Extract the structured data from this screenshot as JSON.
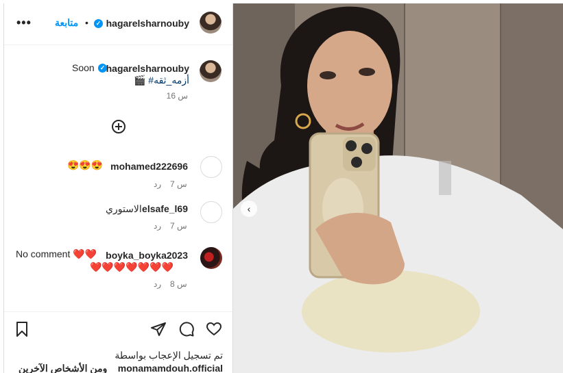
{
  "header": {
    "username": "hagarelsharnouby",
    "follow_label": "متابعة",
    "separator": "•",
    "more_label": "•••"
  },
  "caption": {
    "username": "hagarelsharnouby",
    "text": "Soon",
    "hashtag_line": "🎬 #أزمه_ثقه",
    "time": "16 س"
  },
  "comments": [
    {
      "username": "mohamed222696",
      "text": "😍😍😍",
      "time": "7 س",
      "reply_label": "رد"
    },
    {
      "username": "elsafe_l69",
      "text": "الاستوري",
      "time": "7 س",
      "reply_label": "رد"
    },
    {
      "username": "boyka_boyka2023",
      "text": "No comment ❤️❤️",
      "text_line2": "❤️❤️❤️❤️❤️❤️❤️",
      "time": "8 س",
      "reply_label": "رد"
    }
  ],
  "likes": {
    "line1": "تم تسجيل الإعجاب بواسطة",
    "user": "monamamdouh.official",
    "others": "ومن الأشخاص الآخرين"
  },
  "icons": {
    "header_verified": "verified-badge-icon",
    "add_comment": "plus-circle-icon",
    "like": "heart-icon",
    "comment": "comment-bubble-icon",
    "share": "paper-plane-icon",
    "save": "bookmark-icon",
    "carousel_prev": "chevron-left-icon"
  },
  "colors": {
    "accent": "#0095f6",
    "text": "#262626",
    "muted": "#737373",
    "hashtag": "#00376b",
    "heart": "#e0202a"
  }
}
